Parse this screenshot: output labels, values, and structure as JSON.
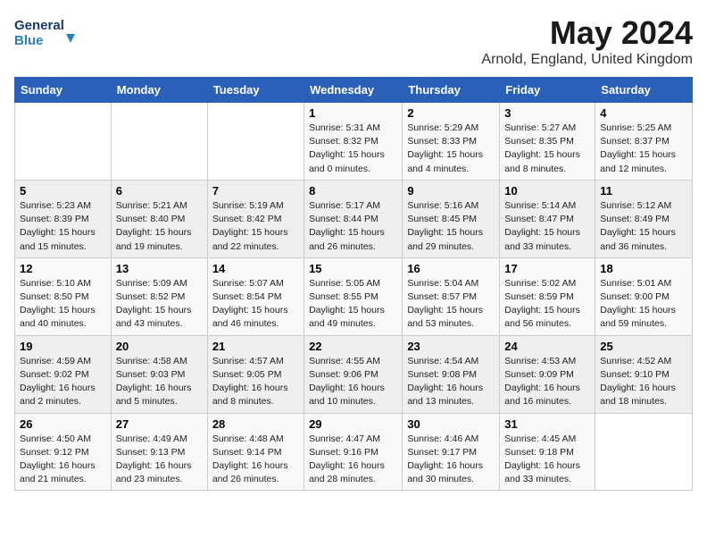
{
  "header": {
    "logo_line1": "General",
    "logo_line2": "Blue",
    "title": "May 2024",
    "subtitle": "Arnold, England, United Kingdom"
  },
  "days_of_week": [
    "Sunday",
    "Monday",
    "Tuesday",
    "Wednesday",
    "Thursday",
    "Friday",
    "Saturday"
  ],
  "weeks": [
    [
      {
        "day": "",
        "info": ""
      },
      {
        "day": "",
        "info": ""
      },
      {
        "day": "",
        "info": ""
      },
      {
        "day": "1",
        "info": "Sunrise: 5:31 AM\nSunset: 8:32 PM\nDaylight: 15 hours\nand 0 minutes."
      },
      {
        "day": "2",
        "info": "Sunrise: 5:29 AM\nSunset: 8:33 PM\nDaylight: 15 hours\nand 4 minutes."
      },
      {
        "day": "3",
        "info": "Sunrise: 5:27 AM\nSunset: 8:35 PM\nDaylight: 15 hours\nand 8 minutes."
      },
      {
        "day": "4",
        "info": "Sunrise: 5:25 AM\nSunset: 8:37 PM\nDaylight: 15 hours\nand 12 minutes."
      }
    ],
    [
      {
        "day": "5",
        "info": "Sunrise: 5:23 AM\nSunset: 8:39 PM\nDaylight: 15 hours\nand 15 minutes."
      },
      {
        "day": "6",
        "info": "Sunrise: 5:21 AM\nSunset: 8:40 PM\nDaylight: 15 hours\nand 19 minutes."
      },
      {
        "day": "7",
        "info": "Sunrise: 5:19 AM\nSunset: 8:42 PM\nDaylight: 15 hours\nand 22 minutes."
      },
      {
        "day": "8",
        "info": "Sunrise: 5:17 AM\nSunset: 8:44 PM\nDaylight: 15 hours\nand 26 minutes."
      },
      {
        "day": "9",
        "info": "Sunrise: 5:16 AM\nSunset: 8:45 PM\nDaylight: 15 hours\nand 29 minutes."
      },
      {
        "day": "10",
        "info": "Sunrise: 5:14 AM\nSunset: 8:47 PM\nDaylight: 15 hours\nand 33 minutes."
      },
      {
        "day": "11",
        "info": "Sunrise: 5:12 AM\nSunset: 8:49 PM\nDaylight: 15 hours\nand 36 minutes."
      }
    ],
    [
      {
        "day": "12",
        "info": "Sunrise: 5:10 AM\nSunset: 8:50 PM\nDaylight: 15 hours\nand 40 minutes."
      },
      {
        "day": "13",
        "info": "Sunrise: 5:09 AM\nSunset: 8:52 PM\nDaylight: 15 hours\nand 43 minutes."
      },
      {
        "day": "14",
        "info": "Sunrise: 5:07 AM\nSunset: 8:54 PM\nDaylight: 15 hours\nand 46 minutes."
      },
      {
        "day": "15",
        "info": "Sunrise: 5:05 AM\nSunset: 8:55 PM\nDaylight: 15 hours\nand 49 minutes."
      },
      {
        "day": "16",
        "info": "Sunrise: 5:04 AM\nSunset: 8:57 PM\nDaylight: 15 hours\nand 53 minutes."
      },
      {
        "day": "17",
        "info": "Sunrise: 5:02 AM\nSunset: 8:59 PM\nDaylight: 15 hours\nand 56 minutes."
      },
      {
        "day": "18",
        "info": "Sunrise: 5:01 AM\nSunset: 9:00 PM\nDaylight: 15 hours\nand 59 minutes."
      }
    ],
    [
      {
        "day": "19",
        "info": "Sunrise: 4:59 AM\nSunset: 9:02 PM\nDaylight: 16 hours\nand 2 minutes."
      },
      {
        "day": "20",
        "info": "Sunrise: 4:58 AM\nSunset: 9:03 PM\nDaylight: 16 hours\nand 5 minutes."
      },
      {
        "day": "21",
        "info": "Sunrise: 4:57 AM\nSunset: 9:05 PM\nDaylight: 16 hours\nand 8 minutes."
      },
      {
        "day": "22",
        "info": "Sunrise: 4:55 AM\nSunset: 9:06 PM\nDaylight: 16 hours\nand 10 minutes."
      },
      {
        "day": "23",
        "info": "Sunrise: 4:54 AM\nSunset: 9:08 PM\nDaylight: 16 hours\nand 13 minutes."
      },
      {
        "day": "24",
        "info": "Sunrise: 4:53 AM\nSunset: 9:09 PM\nDaylight: 16 hours\nand 16 minutes."
      },
      {
        "day": "25",
        "info": "Sunrise: 4:52 AM\nSunset: 9:10 PM\nDaylight: 16 hours\nand 18 minutes."
      }
    ],
    [
      {
        "day": "26",
        "info": "Sunrise: 4:50 AM\nSunset: 9:12 PM\nDaylight: 16 hours\nand 21 minutes."
      },
      {
        "day": "27",
        "info": "Sunrise: 4:49 AM\nSunset: 9:13 PM\nDaylight: 16 hours\nand 23 minutes."
      },
      {
        "day": "28",
        "info": "Sunrise: 4:48 AM\nSunset: 9:14 PM\nDaylight: 16 hours\nand 26 minutes."
      },
      {
        "day": "29",
        "info": "Sunrise: 4:47 AM\nSunset: 9:16 PM\nDaylight: 16 hours\nand 28 minutes."
      },
      {
        "day": "30",
        "info": "Sunrise: 4:46 AM\nSunset: 9:17 PM\nDaylight: 16 hours\nand 30 minutes."
      },
      {
        "day": "31",
        "info": "Sunrise: 4:45 AM\nSunset: 9:18 PM\nDaylight: 16 hours\nand 33 minutes."
      },
      {
        "day": "",
        "info": ""
      }
    ]
  ]
}
